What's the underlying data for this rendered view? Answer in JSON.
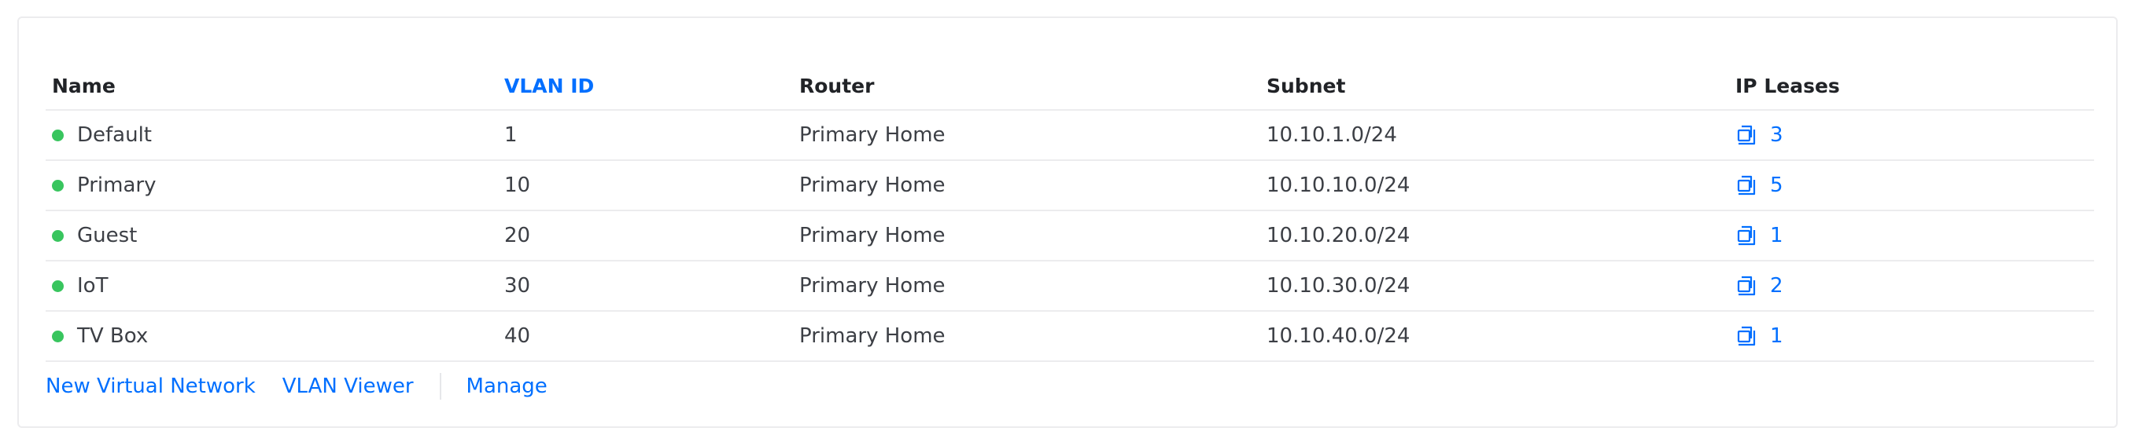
{
  "columns": {
    "name": "Name",
    "vlan_id": "VLAN ID",
    "router": "Router",
    "subnet": "Subnet",
    "ip_leases": "IP Leases"
  },
  "rows": [
    {
      "name": "Default",
      "vlan_id": "1",
      "router": "Primary Home",
      "subnet": "10.10.1.0/24",
      "ip_leases": "3",
      "status": "online"
    },
    {
      "name": "Primary",
      "vlan_id": "10",
      "router": "Primary Home",
      "subnet": "10.10.10.0/24",
      "ip_leases": "5",
      "status": "online"
    },
    {
      "name": "Guest",
      "vlan_id": "20",
      "router": "Primary Home",
      "subnet": "10.10.20.0/24",
      "ip_leases": "1",
      "status": "online"
    },
    {
      "name": "IoT",
      "vlan_id": "30",
      "router": "Primary Home",
      "subnet": "10.10.30.0/24",
      "ip_leases": "2",
      "status": "online"
    },
    {
      "name": "TV Box",
      "vlan_id": "40",
      "router": "Primary Home",
      "subnet": "10.10.40.0/24",
      "ip_leases": "1",
      "status": "online"
    }
  ],
  "footer": {
    "new_network": "New Virtual Network",
    "vlan_viewer": "VLAN Viewer",
    "manage": "Manage"
  },
  "colors": {
    "accent": "#006fff",
    "status_online": "#38c55e",
    "border": "#ececee"
  },
  "icons": {
    "status": "status-dot-icon",
    "leases": "ip-leases-icon"
  }
}
